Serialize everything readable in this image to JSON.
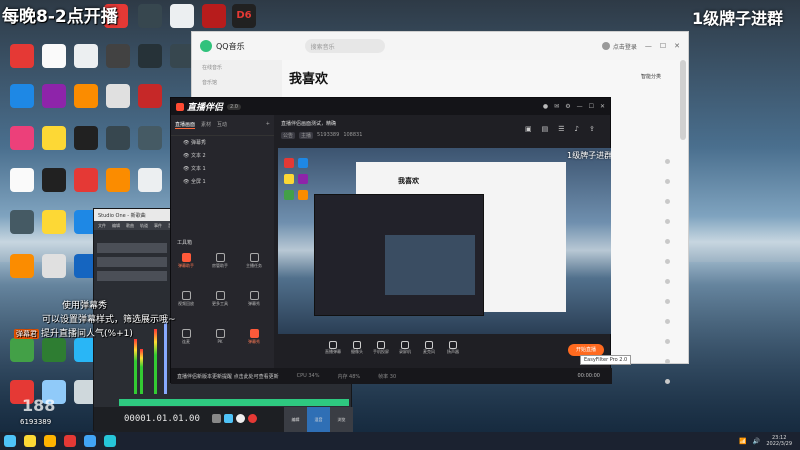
{
  "overlay": {
    "top_left": "每晚8-2点开播",
    "top_right": "1级牌子进群",
    "room_id": "6193389",
    "watermark": "188"
  },
  "danmaku": [
    {
      "tag": "",
      "text": "使用弹幕秀"
    },
    {
      "tag": "",
      "text": "可以设置弹幕样式，筛选展示哦~"
    },
    {
      "tag": "弹幕君",
      "text": "提升直播间人气(%+1)"
    }
  ],
  "desktop_icons": [
    {
      "label": "",
      "color": "#e53935"
    },
    {
      "label": "",
      "color": "#5c6bc0"
    },
    {
      "label": "",
      "color": "#ff9800"
    },
    {
      "label": "",
      "color": "#424242"
    },
    {
      "label": "",
      "color": "#e0e0e0"
    },
    {
      "label": "",
      "color": "#b71c1c"
    },
    {
      "label": "D6",
      "color": "#222"
    }
  ],
  "qq_music": {
    "brand": "QQ音乐",
    "search_placeholder": "搜索音乐",
    "login_text": "点击登录",
    "title": "我喜欢",
    "smart_sort": "智能分类",
    "sidebar": [
      "在线音乐",
      "音乐馆"
    ],
    "row_count": 12
  },
  "zhibo": {
    "app_name": "直播伴侣",
    "version": "2.0",
    "tabs": [
      "直播画面",
      "素材",
      "互动"
    ],
    "sources": [
      "弹幕秀",
      "文本 2",
      "文本 1",
      "全屏 1"
    ],
    "tools_heading": "工具箱",
    "tools": [
      {
        "label": "弹幕助手",
        "hot": true
      },
      {
        "label": "房管助手",
        "hot": false
      },
      {
        "label": "主播任务",
        "hot": false
      },
      {
        "label": "视频回放",
        "hot": false
      },
      {
        "label": "更多工具",
        "hot": false
      },
      {
        "label": "弹幕秀",
        "hot": false
      },
      {
        "label": "连麦",
        "hot": false
      },
      {
        "label": "PK",
        "hot": false
      },
      {
        "label": "弹幕秀",
        "hot": true
      }
    ],
    "live_title": "直播伴侣画面测试，精确",
    "meta": [
      "公告",
      "主播",
      "5193389",
      "108831"
    ],
    "preview_text": "1级牌子进群",
    "preview_title": "我喜欢",
    "bottom_buttons": [
      "直播弹幕",
      "摄像头",
      "手机投屏",
      "录屏机",
      "麦克风",
      "扬声器"
    ],
    "start_button": "开始直播",
    "status_notice": "直播伴侣新版本更新提醒 点击此处可查看更新",
    "status_items": [
      "CPU 34%",
      "内存 48%",
      "帧率 30"
    ],
    "timer": "00:00:00"
  },
  "studio_one": {
    "title": "Studio One - 新歌曲",
    "menu": [
      "文件",
      "编辑",
      "歌曲",
      "轨道",
      "事件",
      "音频",
      "传输",
      "视图",
      "帮助"
    ],
    "timecode": "00001.01.01.00",
    "side_buttons": [
      "编辑",
      "混音",
      "浏览"
    ]
  },
  "tooltip": "EasyFilter Pro 2.0",
  "taskbar": {
    "icons": [
      {
        "name": "windows-icon",
        "color": "#4fc3f7"
      },
      {
        "name": "chrome-icon",
        "color": "#fdd835"
      },
      {
        "name": "explorer-icon",
        "color": "#ffb300"
      },
      {
        "name": "app-icon",
        "color": "#e53935"
      },
      {
        "name": "app-icon",
        "color": "#42a5f5"
      },
      {
        "name": "app-icon",
        "color": "#26c6da"
      }
    ],
    "time": "23:12",
    "date": "2022/3/29"
  }
}
